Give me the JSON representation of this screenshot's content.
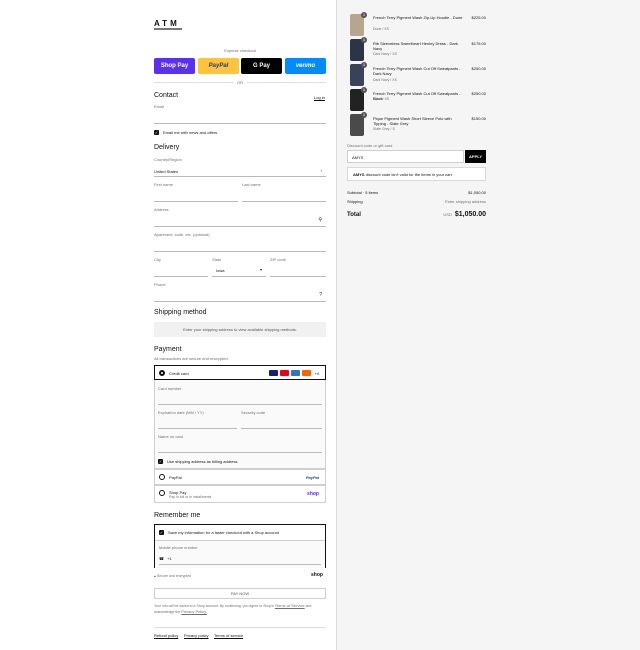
{
  "brand": {
    "logo": "ATM"
  },
  "express": {
    "label": "Express checkout",
    "shop_pay": "Shop Pay",
    "paypal": "PayPal",
    "gpay": "G Pay",
    "venmo": "venmo",
    "or": "OR"
  },
  "contact": {
    "title": "Contact",
    "login": "Log in",
    "email_label": "Email",
    "email_value": "",
    "news_label": "Email me with news and offers"
  },
  "delivery": {
    "title": "Delivery",
    "country_label": "Country/Region",
    "country_value": "United States",
    "first_name": "First name",
    "last_name": "Last name",
    "address": "Address",
    "apartment": "Apartment, suite, etc. (optional)",
    "city": "City",
    "state_label": "State",
    "state_value": "Iowa",
    "zip": "ZIP code",
    "phone": "Phone"
  },
  "shipping": {
    "title": "Shipping method",
    "message": "Enter your shipping address to view available shipping methods."
  },
  "payment": {
    "title": "Payment",
    "subtitle": "All transactions are secure and encrypted.",
    "credit_card": "Credit card",
    "more_cards": "+4",
    "card_number": "Card number",
    "expiry": "Expiration date (MM / YY)",
    "security": "Security code",
    "name_on_card": "Name on card",
    "billing_same": "Use shipping address as billing address",
    "paypal": "PayPal",
    "paypal_logo": "PayPal",
    "shop_pay": "Shop Pay",
    "shop_pay_sub": "Pay in full or in installments",
    "shop_pay_logo": "shop"
  },
  "remember": {
    "title": "Remember me",
    "save_info": "Save my information for a faster checkout with a Shop account",
    "mobile_label": "Mobile phone number",
    "mobile_prefix": "+1",
    "secure_note": "Secure and encrypted",
    "shop_logo": "shop"
  },
  "pay_now": "PAY NOW",
  "legal": {
    "text_before": "Your info will be saved to a Shop account. By continuing, you agree to Shop's",
    "terms": "Terms of Service",
    "text_mid": "and acknowledge the",
    "privacy": "Privacy Policy."
  },
  "footer": {
    "refund": "Refund policy",
    "privacy": "Privacy policy",
    "terms": "Terms of service"
  },
  "cart": {
    "items": [
      {
        "qty": "1",
        "name": "French Terry Pigment Wash Zip-Up Hoodie - Dune",
        "variant": "Dune / XS",
        "price": "$225.00"
      },
      {
        "qty": "1",
        "name": "Rib Sleeveless Sweetheart Henley Dress - Dark Navy",
        "variant": "Dark Navy / XS",
        "price": "$175.00"
      },
      {
        "qty": "1",
        "name": "French Terry Pigment Wash Cut Off Sweatpants - Dark Navy",
        "variant": "Dark Navy / XS",
        "price": "$250.00"
      },
      {
        "qty": "1",
        "name": "French Terry Pigment Wash Cut Off Sweatpants - Black",
        "variant": "Black / XS",
        "price": "$250.00"
      },
      {
        "qty": "1",
        "name": "Pique Pigment Wash Short Sleeve Polo with Tipping - Slate Grey",
        "variant": "Slate Grey / S",
        "price": "$150.00"
      }
    ],
    "discount_label": "Discount code or gift card",
    "discount_value": "AMYS",
    "apply": "APPLY",
    "discount_error_code": "AMYS",
    "discount_error_msg": "discount code isn't valid for the items in your cart",
    "subtotal_label": "Subtotal · 5 items",
    "subtotal_value": "$1,050.00",
    "shipping_label": "Shipping",
    "shipping_value": "Enter shipping address",
    "total_label": "Total",
    "currency": "USD",
    "total_value": "$1,050.00"
  },
  "colors": {
    "shop_pay": "#5a31f4",
    "paypal": "#ffc439",
    "venmo": "#008cff"
  }
}
